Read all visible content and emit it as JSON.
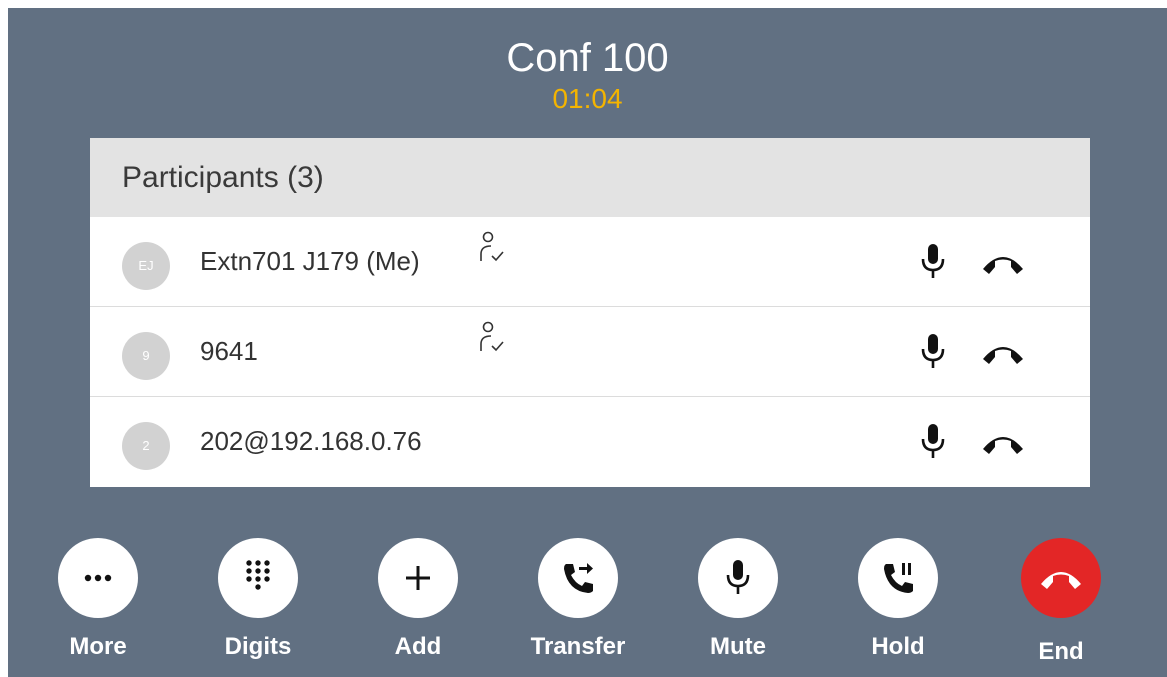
{
  "call": {
    "title": "Conf 100",
    "timer": "01:04"
  },
  "participants": {
    "header": "Participants (3)",
    "rows": [
      {
        "initials": "EJ",
        "name": "Extn701 J179 (Me)",
        "role_icon": "moderator-icon"
      },
      {
        "initials": "9",
        "name": "9641",
        "role_icon": "moderator-icon"
      },
      {
        "initials": "2",
        "name": "202@192.168.0.76",
        "role_icon": ""
      }
    ]
  },
  "controls": [
    {
      "label": "More",
      "icon": "more-icon"
    },
    {
      "label": "Digits",
      "icon": "dialpad-icon"
    },
    {
      "label": "Add",
      "icon": "add-icon"
    },
    {
      "label": "Transfer",
      "icon": "transfer-icon"
    },
    {
      "label": "Mute",
      "icon": "microphone-icon"
    },
    {
      "label": "Hold",
      "icon": "hold-icon"
    },
    {
      "label": "End",
      "icon": "end-call-icon"
    }
  ],
  "colors": {
    "background": "#617082",
    "timer": "#f4b400",
    "end_button": "#e32626",
    "panel_header": "#e3e3e3"
  }
}
